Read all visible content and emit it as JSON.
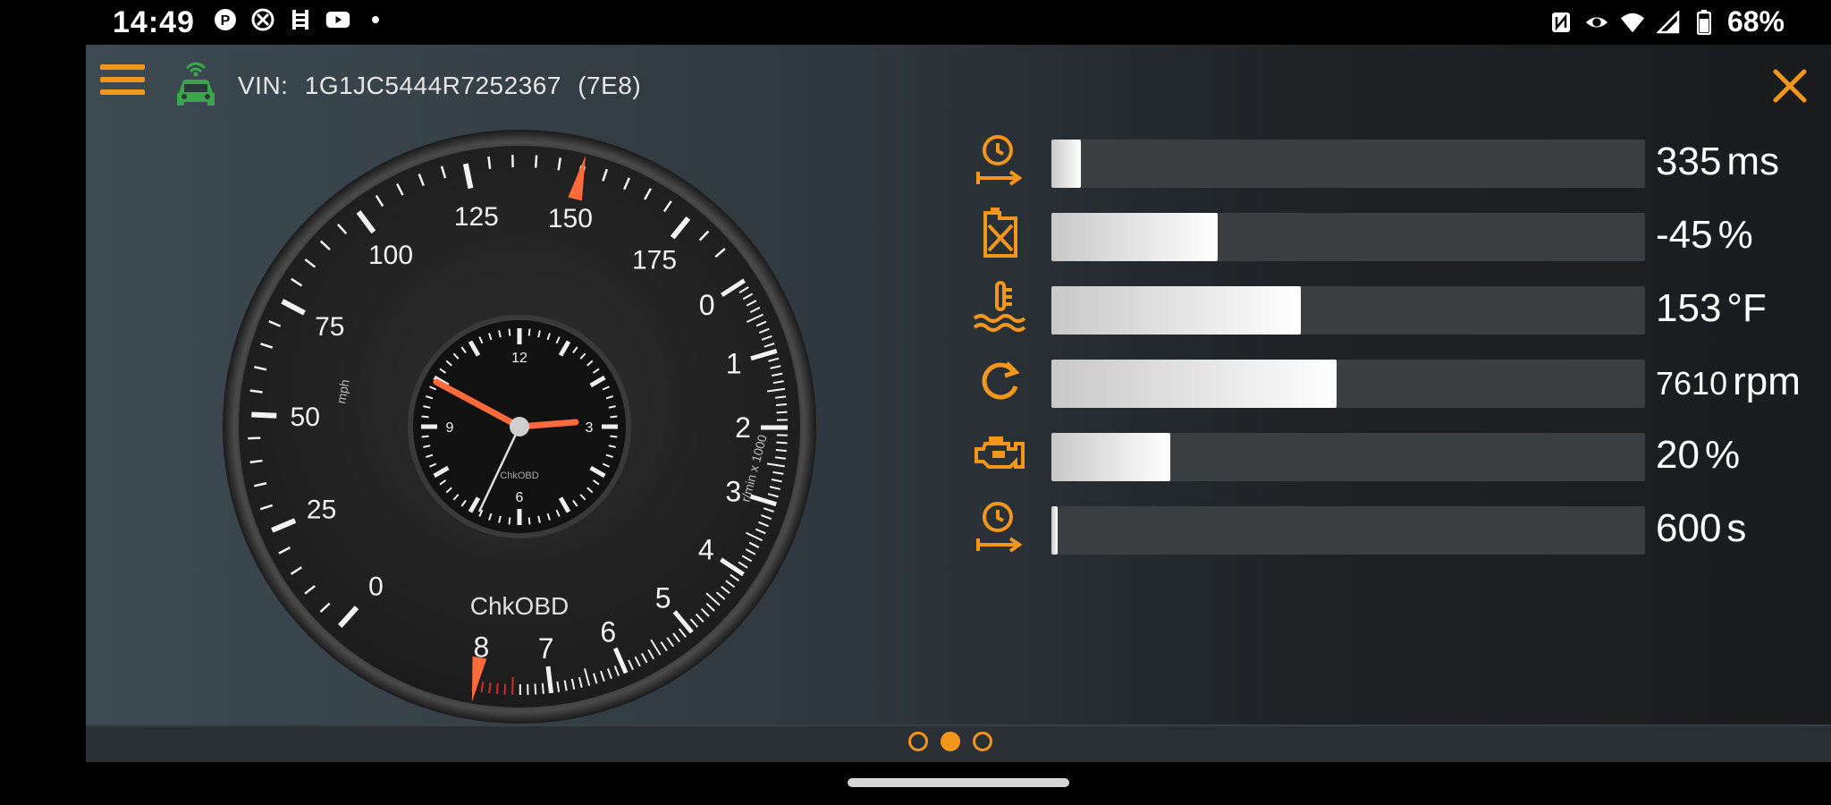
{
  "status_bar": {
    "time": "14:49",
    "left_icons": [
      "p-icon",
      "accessibility-icon",
      "list-icon",
      "youtube-icon",
      "dot-icon"
    ],
    "right_icons": [
      "nfc-icon",
      "eye-icon",
      "wifi-icon",
      "signal-icon",
      "battery-icon"
    ],
    "battery": "68%"
  },
  "header": {
    "vin_label": "VIN:",
    "vin_value": "1G1JC5444R7252367",
    "ecu": "(7E8)"
  },
  "gauge": {
    "brand": "ChkOBD",
    "speed_unit": "mph",
    "rpm_unit": "r/min x 1000",
    "speed_ticks": [
      "0",
      "25",
      "50",
      "75",
      "100",
      "125",
      "150",
      "175"
    ],
    "rpm_ticks": [
      "0",
      "1",
      "2",
      "3",
      "4",
      "5",
      "6",
      "7",
      "8"
    ],
    "clock_numbers": [
      "12",
      "3",
      "6",
      "9"
    ],
    "clock_brand": "ChkOBD",
    "speed_value": 150,
    "rpm_value": 8
  },
  "readings": [
    {
      "icon": "timer-distance-icon",
      "value": "335",
      "unit": "ms",
      "fill": 0.05
    },
    {
      "icon": "fuel-can-icon",
      "value": "-45",
      "unit": "%",
      "fill": 0.28
    },
    {
      "icon": "coolant-temp-icon",
      "value": "153",
      "unit": "°F",
      "fill": 0.42
    },
    {
      "icon": "rpm-refresh-icon",
      "value": "7610",
      "unit": "rpm",
      "fill": 0.48
    },
    {
      "icon": "engine-icon",
      "value": "20",
      "unit": "%",
      "fill": 0.2
    },
    {
      "icon": "timer-distance-icon",
      "value": "600",
      "unit": "s",
      "fill": 0.01
    }
  ],
  "pager": {
    "count": 3,
    "active": 1
  },
  "colors": {
    "accent": "#f3961c",
    "needle": "#ff6a3a",
    "car": "#3aa64a"
  }
}
